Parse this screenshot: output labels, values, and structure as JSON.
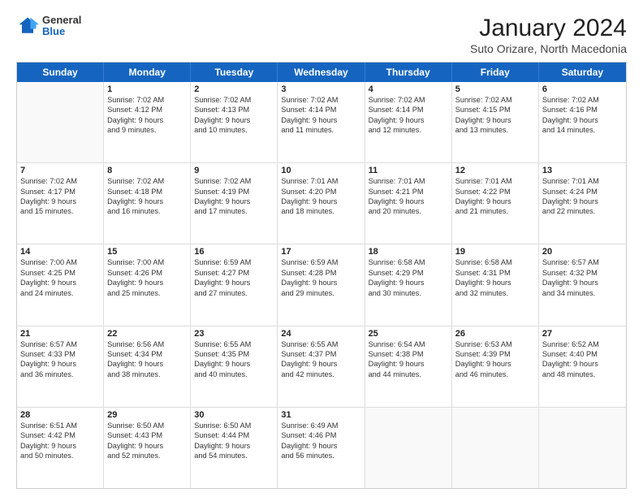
{
  "header": {
    "logo": {
      "general": "General",
      "blue": "Blue"
    },
    "title": "January 2024",
    "subtitle": "Suto Orizare, North Macedonia"
  },
  "calendar": {
    "days_of_week": [
      "Sunday",
      "Monday",
      "Tuesday",
      "Wednesday",
      "Thursday",
      "Friday",
      "Saturday"
    ],
    "weeks": [
      [
        {
          "day": "",
          "empty": true
        },
        {
          "day": "1",
          "sunrise": "Sunrise: 7:02 AM",
          "sunset": "Sunset: 4:12 PM",
          "daylight": "Daylight: 9 hours and 9 minutes."
        },
        {
          "day": "2",
          "sunrise": "Sunrise: 7:02 AM",
          "sunset": "Sunset: 4:13 PM",
          "daylight": "Daylight: 9 hours and 10 minutes."
        },
        {
          "day": "3",
          "sunrise": "Sunrise: 7:02 AM",
          "sunset": "Sunset: 4:14 PM",
          "daylight": "Daylight: 9 hours and 11 minutes."
        },
        {
          "day": "4",
          "sunrise": "Sunrise: 7:02 AM",
          "sunset": "Sunset: 4:14 PM",
          "daylight": "Daylight: 9 hours and 12 minutes."
        },
        {
          "day": "5",
          "sunrise": "Sunrise: 7:02 AM",
          "sunset": "Sunset: 4:15 PM",
          "daylight": "Daylight: 9 hours and 13 minutes."
        },
        {
          "day": "6",
          "sunrise": "Sunrise: 7:02 AM",
          "sunset": "Sunset: 4:16 PM",
          "daylight": "Daylight: 9 hours and 14 minutes."
        }
      ],
      [
        {
          "day": "7",
          "sunrise": "Sunrise: 7:02 AM",
          "sunset": "Sunset: 4:17 PM",
          "daylight": "Daylight: 9 hours and 15 minutes."
        },
        {
          "day": "8",
          "sunrise": "Sunrise: 7:02 AM",
          "sunset": "Sunset: 4:18 PM",
          "daylight": "Daylight: 9 hours and 16 minutes."
        },
        {
          "day": "9",
          "sunrise": "Sunrise: 7:02 AM",
          "sunset": "Sunset: 4:19 PM",
          "daylight": "Daylight: 9 hours and 17 minutes."
        },
        {
          "day": "10",
          "sunrise": "Sunrise: 7:01 AM",
          "sunset": "Sunset: 4:20 PM",
          "daylight": "Daylight: 9 hours and 18 minutes."
        },
        {
          "day": "11",
          "sunrise": "Sunrise: 7:01 AM",
          "sunset": "Sunset: 4:21 PM",
          "daylight": "Daylight: 9 hours and 20 minutes."
        },
        {
          "day": "12",
          "sunrise": "Sunrise: 7:01 AM",
          "sunset": "Sunset: 4:22 PM",
          "daylight": "Daylight: 9 hours and 21 minutes."
        },
        {
          "day": "13",
          "sunrise": "Sunrise: 7:01 AM",
          "sunset": "Sunset: 4:24 PM",
          "daylight": "Daylight: 9 hours and 22 minutes."
        }
      ],
      [
        {
          "day": "14",
          "sunrise": "Sunrise: 7:00 AM",
          "sunset": "Sunset: 4:25 PM",
          "daylight": "Daylight: 9 hours and 24 minutes."
        },
        {
          "day": "15",
          "sunrise": "Sunrise: 7:00 AM",
          "sunset": "Sunset: 4:26 PM",
          "daylight": "Daylight: 9 hours and 25 minutes."
        },
        {
          "day": "16",
          "sunrise": "Sunrise: 6:59 AM",
          "sunset": "Sunset: 4:27 PM",
          "daylight": "Daylight: 9 hours and 27 minutes."
        },
        {
          "day": "17",
          "sunrise": "Sunrise: 6:59 AM",
          "sunset": "Sunset: 4:28 PM",
          "daylight": "Daylight: 9 hours and 29 minutes."
        },
        {
          "day": "18",
          "sunrise": "Sunrise: 6:58 AM",
          "sunset": "Sunset: 4:29 PM",
          "daylight": "Daylight: 9 hours and 30 minutes."
        },
        {
          "day": "19",
          "sunrise": "Sunrise: 6:58 AM",
          "sunset": "Sunset: 4:31 PM",
          "daylight": "Daylight: 9 hours and 32 minutes."
        },
        {
          "day": "20",
          "sunrise": "Sunrise: 6:57 AM",
          "sunset": "Sunset: 4:32 PM",
          "daylight": "Daylight: 9 hours and 34 minutes."
        }
      ],
      [
        {
          "day": "21",
          "sunrise": "Sunrise: 6:57 AM",
          "sunset": "Sunset: 4:33 PM",
          "daylight": "Daylight: 9 hours and 36 minutes."
        },
        {
          "day": "22",
          "sunrise": "Sunrise: 6:56 AM",
          "sunset": "Sunset: 4:34 PM",
          "daylight": "Daylight: 9 hours and 38 minutes."
        },
        {
          "day": "23",
          "sunrise": "Sunrise: 6:55 AM",
          "sunset": "Sunset: 4:35 PM",
          "daylight": "Daylight: 9 hours and 40 minutes."
        },
        {
          "day": "24",
          "sunrise": "Sunrise: 6:55 AM",
          "sunset": "Sunset: 4:37 PM",
          "daylight": "Daylight: 9 hours and 42 minutes."
        },
        {
          "day": "25",
          "sunrise": "Sunrise: 6:54 AM",
          "sunset": "Sunset: 4:38 PM",
          "daylight": "Daylight: 9 hours and 44 minutes."
        },
        {
          "day": "26",
          "sunrise": "Sunrise: 6:53 AM",
          "sunset": "Sunset: 4:39 PM",
          "daylight": "Daylight: 9 hours and 46 minutes."
        },
        {
          "day": "27",
          "sunrise": "Sunrise: 6:52 AM",
          "sunset": "Sunset: 4:40 PM",
          "daylight": "Daylight: 9 hours and 48 minutes."
        }
      ],
      [
        {
          "day": "28",
          "sunrise": "Sunrise: 6:51 AM",
          "sunset": "Sunset: 4:42 PM",
          "daylight": "Daylight: 9 hours and 50 minutes."
        },
        {
          "day": "29",
          "sunrise": "Sunrise: 6:50 AM",
          "sunset": "Sunset: 4:43 PM",
          "daylight": "Daylight: 9 hours and 52 minutes."
        },
        {
          "day": "30",
          "sunrise": "Sunrise: 6:50 AM",
          "sunset": "Sunset: 4:44 PM",
          "daylight": "Daylight: 9 hours and 54 minutes."
        },
        {
          "day": "31",
          "sunrise": "Sunrise: 6:49 AM",
          "sunset": "Sunset: 4:46 PM",
          "daylight": "Daylight: 9 hours and 56 minutes."
        },
        {
          "day": "",
          "empty": true
        },
        {
          "day": "",
          "empty": true
        },
        {
          "day": "",
          "empty": true
        }
      ]
    ]
  }
}
